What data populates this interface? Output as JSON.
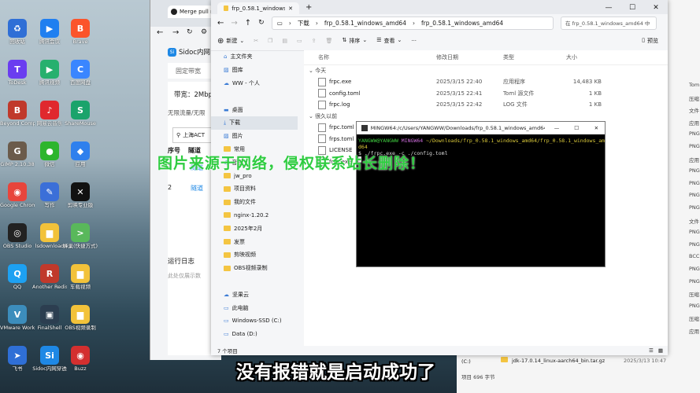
{
  "desktop_icons": [
    {
      "label": "回收站",
      "color": "#2f6fd6",
      "glyph": "♻"
    },
    {
      "label": "腾讯会议",
      "color": "#1f7ff0",
      "glyph": "▶"
    },
    {
      "label": "Brave",
      "color": "#fb542b",
      "glyph": "B"
    },
    {
      "label": "ToDesk",
      "color": "#6a3df0",
      "glyph": "T"
    },
    {
      "label": "腾讯视频",
      "color": "#26b06e",
      "glyph": "▶"
    },
    {
      "label": "百度网盘",
      "color": "#3a86ff",
      "glyph": "C"
    },
    {
      "label": "Beyond Compare 5",
      "color": "#c0392b",
      "glyph": "B"
    },
    {
      "label": "网易云音乐",
      "color": "#e0282e",
      "glyph": "♪"
    },
    {
      "label": "ShareMouse",
      "color": "#1aa36b",
      "glyph": "S"
    },
    {
      "label": "GIMP 2.10.38",
      "color": "#6b5b4b",
      "glyph": "G"
    },
    {
      "label": "微信",
      "color": "#2db52d",
      "glyph": "●"
    },
    {
      "label": "应用",
      "color": "#2f80ed",
      "glyph": "◆"
    },
    {
      "label": "Google Chrome",
      "color": "#e8453c",
      "glyph": "◉"
    },
    {
      "label": "写作",
      "color": "#3b6fd8",
      "glyph": "✎"
    },
    {
      "label": "剪映专业版",
      "color": "#111111",
      "glyph": "✕"
    },
    {
      "label": "OBS Studio",
      "color": "#222222",
      "glyph": "◎"
    },
    {
      "label": "lsdownload",
      "color": "#f2c23a",
      "glyph": "▆"
    },
    {
      "label": "蜂巢(快捷方式)",
      "color": "#59b85b",
      "glyph": ">"
    },
    {
      "label": "QQ",
      "color": "#1da1f2",
      "glyph": "Q"
    },
    {
      "label": "Another Redis D...",
      "color": "#c0392b",
      "glyph": "R"
    },
    {
      "label": "车载视频",
      "color": "#f2c23a",
      "glyph": "▆"
    },
    {
      "label": "VMware Workstati...",
      "color": "#3c8dbc",
      "glyph": "V"
    },
    {
      "label": "FinalShell",
      "color": "#2c3e50",
      "glyph": "▣"
    },
    {
      "label": "OBS视频录制",
      "color": "#f2c23a",
      "glyph": "▆"
    },
    {
      "label": "飞书",
      "color": "#2f6fd6",
      "glyph": "➤"
    },
    {
      "label": "Sidoc内网穿透",
      "color": "#1e88e5",
      "glyph": "Si"
    },
    {
      "label": "Buzz",
      "color": "#d32f2f",
      "glyph": "◉"
    }
  ],
  "browser": {
    "tab_title": "Merge pull re",
    "panel_title": "Sidoc内网",
    "menu_item": "固定带宽",
    "bandwidth_label": "带宽：2Mbp",
    "limit_note": "无限流量/无限",
    "region": "上海ACT",
    "col_seq": "序号",
    "col_tunnel": "隧道",
    "row1_seq": "1",
    "row1_tunnel": "隧道",
    "row2_seq": "2",
    "row2_tunnel": "隧道",
    "log_title": "运行日志",
    "log_empty": "此处仅展示数"
  },
  "explorer": {
    "tab_title": "frp_0.58.1_windows_amd64",
    "breadcrumb": [
      "下载",
      "frp_0.58.1_windows_amd64",
      "frp_0.58.1_windows_amd64"
    ],
    "search_placeholder": "在 frp_0.58.1_windows_amd64 中",
    "new_label": "新建",
    "sort_label": "排序",
    "view_label": "查看",
    "details_label": "预览",
    "nav": [
      {
        "label": "主文件夹",
        "icon": "home"
      },
      {
        "label": "图库",
        "icon": "gallery"
      },
      {
        "label": "WW - 个人",
        "icon": "cloud"
      },
      {
        "label": "",
        "icon": "blank"
      },
      {
        "label": "桌面",
        "icon": "desktop"
      },
      {
        "label": "下载",
        "icon": "download",
        "selected": true
      },
      {
        "label": "图片",
        "icon": "picture"
      },
      {
        "label": "常用",
        "icon": "folder"
      },
      {
        "label": "音乐",
        "icon": "music"
      },
      {
        "label": "jw_pro",
        "icon": "folder"
      },
      {
        "label": "项目资料",
        "icon": "folder"
      },
      {
        "label": "我的文件",
        "icon": "folder"
      },
      {
        "label": "nginx-1.20.2",
        "icon": "folder"
      },
      {
        "label": "2025年2月",
        "icon": "folder"
      },
      {
        "label": "发票",
        "icon": "folder"
      },
      {
        "label": "剪映视频",
        "icon": "folder"
      },
      {
        "label": "OBS视频录制",
        "icon": "folder"
      },
      {
        "label": "",
        "icon": "blank"
      },
      {
        "label": "坚果云",
        "icon": "cloud"
      },
      {
        "label": "此电脑",
        "icon": "pc"
      },
      {
        "label": "Windows-SSD (C:)",
        "icon": "drive"
      },
      {
        "label": "Data (D:)",
        "icon": "drive"
      }
    ],
    "columns": [
      "名称",
      "修改日期",
      "类型",
      "大小"
    ],
    "group_today": "今天",
    "group_earlier": "很久以前",
    "files_today": [
      {
        "name": "frpc.exe",
        "date": "2025/3/15 22:40",
        "type": "应用程序",
        "size": "14,483 KB"
      },
      {
        "name": "config.toml",
        "date": "2025/3/15 22:41",
        "type": "Toml 源文件",
        "size": "1 KB"
      },
      {
        "name": "frpc.log",
        "date": "2025/3/15 22:42",
        "type": "LOG 文件",
        "size": "1 KB"
      }
    ],
    "files_earlier": [
      {
        "name": "frpc.toml"
      },
      {
        "name": "frps.toml"
      },
      {
        "name": "LICENSE"
      },
      {
        "name": "frps.exe"
      }
    ],
    "status": "7 个项目"
  },
  "terminal": {
    "title": "MINGW64:/c/Users/YANGWW/Downloads/frp_0.58.1_windows_amd64/frp_0.58...",
    "prompt_user": "YANGWW@YANGWW",
    "prompt_env": "MINGW64",
    "prompt_path": "~/Downloads/frp_0.58.1_windows_amd64/frp_0.58.1_windows_am",
    "prompt_path_wrap": "d64",
    "command": "$ ./frpc.exe -c ./config.toml"
  },
  "right_panel": {
    "items": [
      "Tom",
      "压缩",
      "文件",
      "应用",
      "PNG",
      "PNG",
      "应用",
      "PNG",
      "PNG",
      "PNG",
      "PNG",
      "文件",
      "PNG",
      "PNG",
      "BCC",
      "PNG",
      "PNG",
      "压缩",
      "PNG",
      "压缩",
      "应用"
    ]
  },
  "background_window": {
    "row_name": "jdk-17.0.14_linux-aarch64_bin.tar.gz",
    "row_date": "2025/3/13 10:47",
    "drive_label": "(C:)",
    "status": "项目 696 字节"
  },
  "watermark": "图片来源于网络，侵权联系站长删除！",
  "subtitle": "没有报错就是启动成功了"
}
